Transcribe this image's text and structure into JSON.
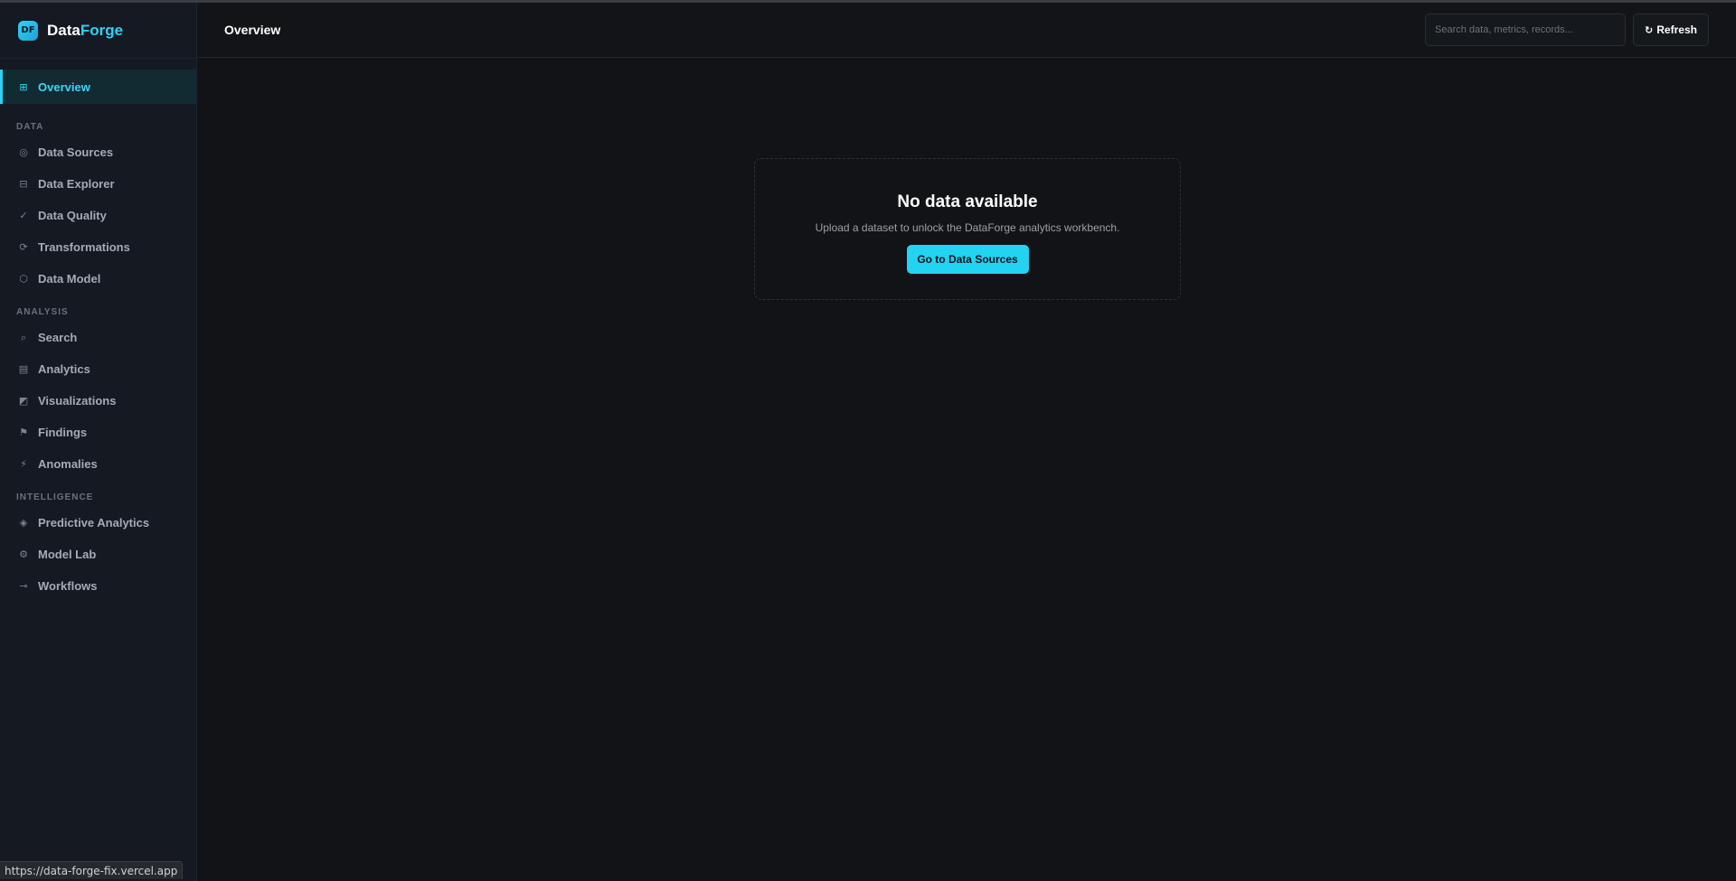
{
  "brand": {
    "badge": "DF",
    "name_part1": "Data",
    "name_part2": "Forge"
  },
  "sidebar": {
    "overview": {
      "label": "Overview",
      "icon": "grid-icon",
      "glyph": "⊞"
    },
    "sections": [
      {
        "label": "DATA",
        "items": [
          {
            "label": "Data Sources",
            "icon": "database-icon",
            "glyph": "◎"
          },
          {
            "label": "Data Explorer",
            "icon": "table-icon",
            "glyph": "⊟"
          },
          {
            "label": "Data Quality",
            "icon": "check-icon",
            "glyph": "✓"
          },
          {
            "label": "Transformations",
            "icon": "transform-icon",
            "glyph": "⟳"
          },
          {
            "label": "Data Model",
            "icon": "hexagon-icon",
            "glyph": "⬡"
          }
        ]
      },
      {
        "label": "ANALYSIS",
        "items": [
          {
            "label": "Search",
            "icon": "search-icon",
            "glyph": "⌕"
          },
          {
            "label": "Analytics",
            "icon": "bar-chart-icon",
            "glyph": "▤"
          },
          {
            "label": "Visualizations",
            "icon": "chart-icon",
            "glyph": "◩"
          },
          {
            "label": "Findings",
            "icon": "flag-icon",
            "glyph": "⚑"
          },
          {
            "label": "Anomalies",
            "icon": "lightning-icon",
            "glyph": "⚡"
          }
        ]
      },
      {
        "label": "INTELLIGENCE",
        "items": [
          {
            "label": "Predictive Analytics",
            "icon": "diamond-icon",
            "glyph": "◈"
          },
          {
            "label": "Model Lab",
            "icon": "gear-icon",
            "glyph": "⚙"
          },
          {
            "label": "Workflows",
            "icon": "arrow-icon",
            "glyph": "⊸"
          }
        ]
      }
    ]
  },
  "header": {
    "title": "Overview",
    "search_placeholder": "Search data, metrics, records...",
    "refresh_label": "Refresh",
    "refresh_glyph": "↻"
  },
  "empty_state": {
    "title": "No data available",
    "subtitle": "Upload a dataset to unlock the DataForge analytics workbench.",
    "cta_label": "Go to Data Sources"
  },
  "status_bar": {
    "url": "https://data-forge-fix.vercel.app"
  },
  "colors": {
    "accent": "#22d3f2",
    "background": "#111317",
    "sidebar": "#141922"
  }
}
